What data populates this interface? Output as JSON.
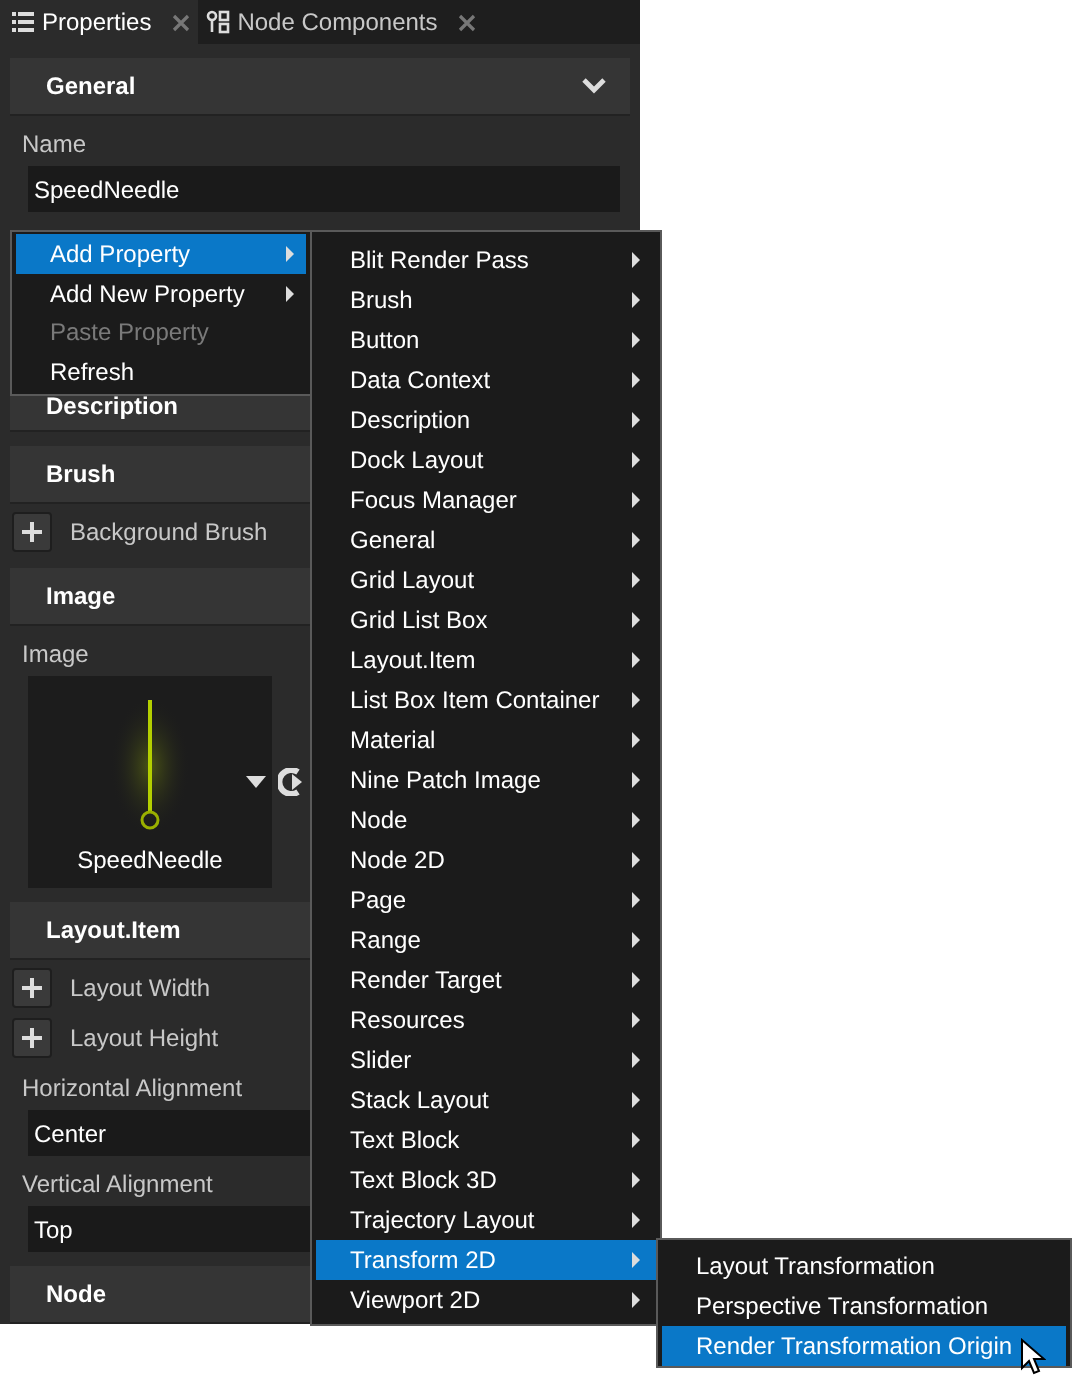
{
  "tabs": [
    {
      "label": "Properties",
      "selected": true
    },
    {
      "label": "Node Components",
      "selected": false
    }
  ],
  "panel": [
    {
      "kind": "header",
      "label": "General",
      "expanded": true
    },
    {
      "kind": "label",
      "text": "Name"
    },
    {
      "kind": "field",
      "value": "SpeedNeedle"
    },
    {
      "kind": "header",
      "label": "Description"
    },
    {
      "kind": "header",
      "label": "Brush"
    },
    {
      "kind": "add",
      "label": "Background Brush"
    },
    {
      "kind": "header",
      "label": "Image"
    },
    {
      "kind": "label",
      "text": "Image"
    },
    {
      "kind": "image",
      "caption": "SpeedNeedle"
    },
    {
      "kind": "header",
      "label": "Layout.Item"
    },
    {
      "kind": "add",
      "label": "Layout Width"
    },
    {
      "kind": "add",
      "label": "Layout Height"
    },
    {
      "kind": "label",
      "text": "Horizontal Alignment"
    },
    {
      "kind": "field",
      "value": "Center"
    },
    {
      "kind": "label",
      "text": "Vertical Alignment"
    },
    {
      "kind": "field",
      "value": "Top"
    },
    {
      "kind": "header",
      "label": "Node"
    }
  ],
  "context_menu": [
    {
      "label": "Add Property",
      "submenu": true,
      "selected": true,
      "disabled": false
    },
    {
      "label": "Add New Property",
      "submenu": true,
      "selected": false,
      "disabled": false
    },
    {
      "label": "Paste Property",
      "submenu": false,
      "selected": false,
      "disabled": true
    },
    {
      "label": "Refresh",
      "submenu": false,
      "selected": false,
      "disabled": false
    }
  ],
  "property_menu": [
    {
      "label": "Blit Render Pass",
      "selected": false
    },
    {
      "label": "Brush",
      "selected": false
    },
    {
      "label": "Button",
      "selected": false
    },
    {
      "label": "Data Context",
      "selected": false
    },
    {
      "label": "Description",
      "selected": false
    },
    {
      "label": "Dock Layout",
      "selected": false
    },
    {
      "label": "Focus Manager",
      "selected": false
    },
    {
      "label": "General",
      "selected": false
    },
    {
      "label": "Grid Layout",
      "selected": false
    },
    {
      "label": "Grid List Box",
      "selected": false
    },
    {
      "label": "Layout.Item",
      "selected": false
    },
    {
      "label": "List Box Item Container",
      "selected": false
    },
    {
      "label": "Material",
      "selected": false
    },
    {
      "label": "Nine Patch Image",
      "selected": false
    },
    {
      "label": "Node",
      "selected": false
    },
    {
      "label": "Node 2D",
      "selected": false
    },
    {
      "label": "Page",
      "selected": false
    },
    {
      "label": "Range",
      "selected": false
    },
    {
      "label": "Render Target",
      "selected": false
    },
    {
      "label": "Resources",
      "selected": false
    },
    {
      "label": "Slider",
      "selected": false
    },
    {
      "label": "Stack Layout",
      "selected": false
    },
    {
      "label": "Text Block",
      "selected": false
    },
    {
      "label": "Text Block 3D",
      "selected": false
    },
    {
      "label": "Trajectory Layout",
      "selected": false
    },
    {
      "label": "Transform 2D",
      "selected": true
    },
    {
      "label": "Viewport 2D",
      "selected": false
    }
  ],
  "transform_menu": [
    {
      "label": "Layout Transformation",
      "selected": false
    },
    {
      "label": "Perspective Transformation",
      "selected": false
    },
    {
      "label": "Render Transformation Origin",
      "selected": true
    }
  ]
}
